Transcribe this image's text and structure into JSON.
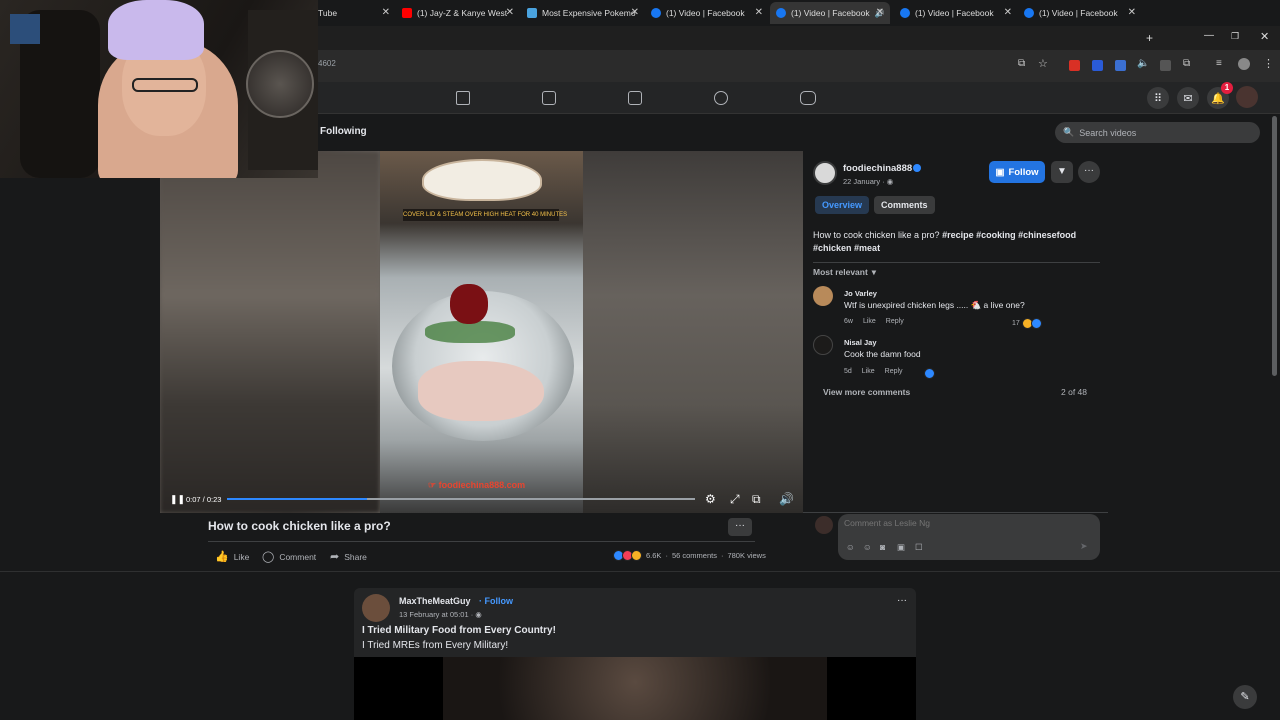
{
  "browser": {
    "tabs": [
      {
        "label": "Tube",
        "favicon": "youtube-icon",
        "color": "#ff0000"
      },
      {
        "label": "(1) Jay-Z & Kanye West",
        "favicon": "youtube-icon",
        "color": "#ff0000"
      },
      {
        "label": "Most Expensive Pokemo",
        "favicon": "site-icon",
        "color": "#4aa3df"
      },
      {
        "label": "(1) Video | Facebook",
        "favicon": "facebook-icon",
        "color": "#1877f2"
      },
      {
        "label": "(1) Video | Facebook",
        "favicon": "facebook-icon",
        "color": "#1877f2",
        "active": true
      },
      {
        "label": "(1) Video | Facebook",
        "favicon": "facebook-icon",
        "color": "#1877f2"
      },
      {
        "label": "(1) Video | Facebook",
        "favicon": "facebook-icon",
        "color": "#1877f2"
      }
    ],
    "url_fragment": "4602"
  },
  "fb_nav": {
    "notification_count": "1",
    "accent": "#2374e1"
  },
  "watch": {
    "following_tab": "Following",
    "search_placeholder": "Search videos"
  },
  "video": {
    "banner_text": "COVER LID & STEAM OVER HIGH HEAT FOR 40 MINUTES",
    "watermark": "foodiechina888.com",
    "time": "0:07 / 0:23",
    "progress": 0.3,
    "title": "How to cook chicken like a pro?",
    "actions": {
      "like": "Like",
      "comment": "Comment",
      "share": "Share"
    },
    "reaction_count": "6.6K",
    "comments_count": "56 comments",
    "views": "780K views"
  },
  "panel": {
    "author": "foodiechina888",
    "date": "22 January",
    "follow_label": "Follow",
    "tabs": {
      "overview": "Overview",
      "comments": "Comments"
    },
    "caption_text": "How to cook chicken like a pro? ",
    "caption_tags": [
      "#recipe",
      "#cooking",
      "#chinesefood",
      "#chicken",
      "#meat"
    ],
    "sort_label": "Most relevant",
    "comments": [
      {
        "name": "Jo Varley",
        "text": "Wtf is unexpired chicken legs ..... 🐔 a live one?",
        "age": "6w",
        "like": "Like",
        "reply": "Reply",
        "reactions": "17"
      },
      {
        "name": "Nisal Jay",
        "text": "Cook the damn food",
        "age": "5d",
        "like": "Like",
        "reply": "Reply",
        "reactions": ""
      }
    ],
    "view_more": "View more comments",
    "comment_count": "2 of 48",
    "composer_placeholder": "Comment as Leslie Ng"
  },
  "next_post": {
    "author": "MaxTheMeatGuy",
    "follow_label": "Follow",
    "date": "13 February at 05:01",
    "title": "I Tried Military Food from Every Country!",
    "subtitle": "I Tried MREs from Every Military!"
  }
}
